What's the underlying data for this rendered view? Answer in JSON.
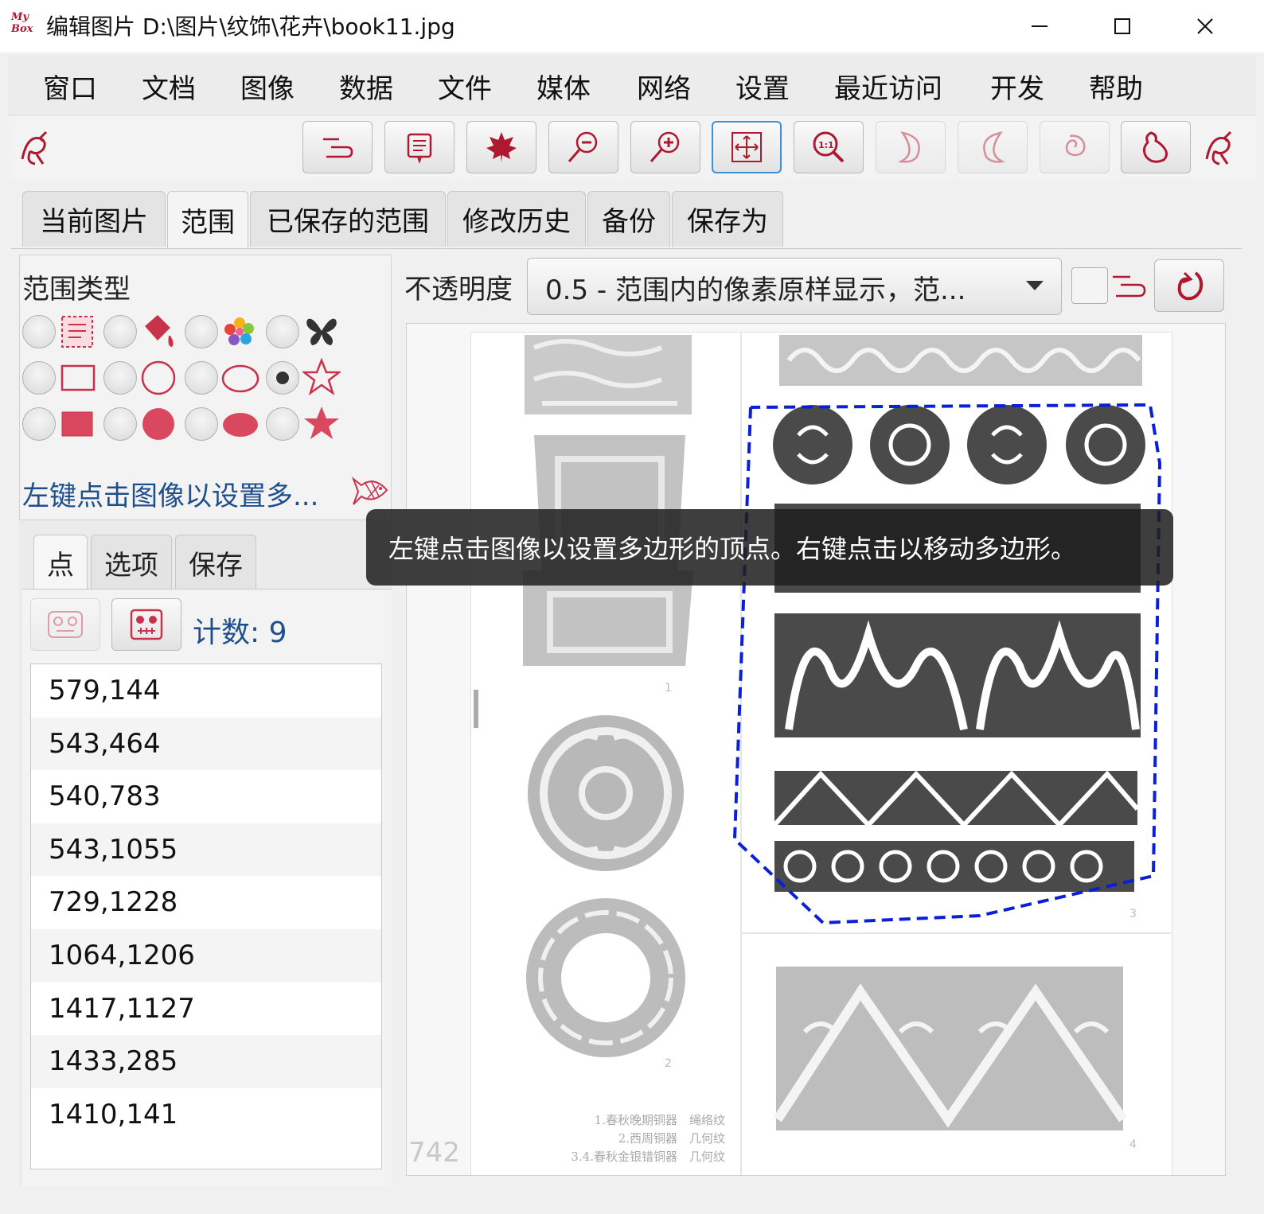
{
  "window": {
    "logo_text": "My Box",
    "title": "编辑图片 D:\\图片\\纹饰\\花卉\\book11.jpg",
    "controls": [
      "minimize",
      "maximize",
      "close"
    ]
  },
  "menu": [
    "窗口",
    "文档",
    "图像",
    "数据",
    "文件",
    "媒体",
    "网络",
    "设置",
    "最近访问",
    "开发",
    "帮助"
  ],
  "toolbar": {
    "icons": [
      "menu-lines-icon",
      "text-document-icon",
      "maple-leaf-icon",
      "zoom-out-icon",
      "zoom-in-icon",
      "fit-window-icon",
      "actual-size-icon",
      "rotate-right-icon",
      "rotate-left-icon",
      "spiral-icon",
      "gourd-icon"
    ]
  },
  "tabs": [
    "当前图片",
    "范围",
    "已保存的范围",
    "修改历史",
    "备份",
    "保存为"
  ],
  "selected_tab": "范围",
  "scope": {
    "section_title": "范围类型",
    "hint": "左键点击图像以设置多...",
    "selected_type": "polygon-outline"
  },
  "subtabs": [
    "点",
    "选项",
    "保存"
  ],
  "points": {
    "count_label": "计数: 9",
    "items": [
      "579,144",
      "543,464",
      "540,783",
      "543,1055",
      "729,1228",
      "1064,1206",
      "1417,1127",
      "1433,285",
      "1410,141"
    ]
  },
  "opacity": {
    "label": "不透明度",
    "value": "0.5 - 范围内的像素原样显示，范..."
  },
  "image": {
    "page_number": "742",
    "captions": [
      "1.春秋晚期铜器　绳络纹",
      "2.西周铜器　几何纹",
      "3.4.春秋金银错铜器　几何纹"
    ],
    "figure_numbers": [
      "1",
      "2",
      "3",
      "4"
    ]
  },
  "tooltip": "左键点击图像以设置多边形的顶点。右键点击以移动多边形。",
  "colors": {
    "accent": "#b0182f",
    "selection": "#0a1fd8",
    "link": "#1f4e8c"
  }
}
